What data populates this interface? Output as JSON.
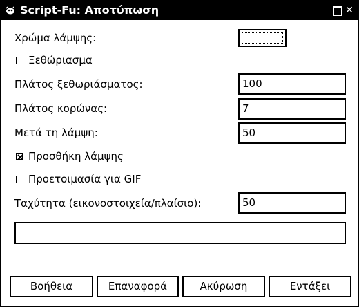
{
  "window": {
    "title": "Script-Fu: Αποτύπωση"
  },
  "form": {
    "glow_color_label": "Χρώμα λάμψης:",
    "glow_color_value": "#ffffff",
    "feather_label": "Ξεθώριασμα",
    "feather_checked": false,
    "feather_width_label": "Πλάτος ξεθωριάσματος:",
    "feather_width_value": "100",
    "corona_width_label": "Πλάτος κορώνας:",
    "corona_width_value": "7",
    "after_glow_label": "Μετά τη λάμψη:",
    "after_glow_value": "50",
    "add_glow_label": "Προσθήκη λάμψης",
    "add_glow_checked": true,
    "gif_label": "Προετοιμασία για GIF",
    "gif_checked": false,
    "speed_label": "Ταχύτητα (εικονοστοιχεία/πλαίσιο):",
    "speed_value": "50"
  },
  "buttons": {
    "help": "Βοήθεια",
    "reset": "Επαναφορά",
    "cancel": "Ακύρωση",
    "ok": "Εντάξει"
  }
}
